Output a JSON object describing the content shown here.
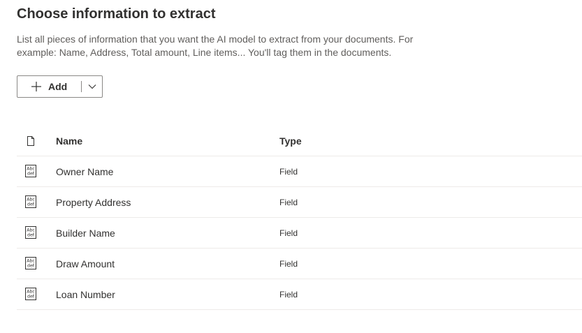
{
  "page": {
    "title": "Choose information to extract",
    "description": "List all pieces of information that you want the AI model to extract from your documents. For example: Name, Address, Total amount, Line items... You'll tag them in the documents."
  },
  "toolbar": {
    "add_label": "Add",
    "add_icon": "plus-icon",
    "dropdown_icon": "chevron-down-icon"
  },
  "table": {
    "columns": {
      "icon": "document-icon",
      "name": "Name",
      "type": "Type"
    },
    "rows": [
      {
        "name": "Owner Name",
        "type": "Field",
        "icon": "text-field-icon"
      },
      {
        "name": "Property Address",
        "type": "Field",
        "icon": "text-field-icon"
      },
      {
        "name": "Builder Name",
        "type": "Field",
        "icon": "text-field-icon"
      },
      {
        "name": "Draw Amount",
        "type": "Field",
        "icon": "text-field-icon"
      },
      {
        "name": "Loan Number",
        "type": "Field",
        "icon": "text-field-icon"
      }
    ]
  }
}
